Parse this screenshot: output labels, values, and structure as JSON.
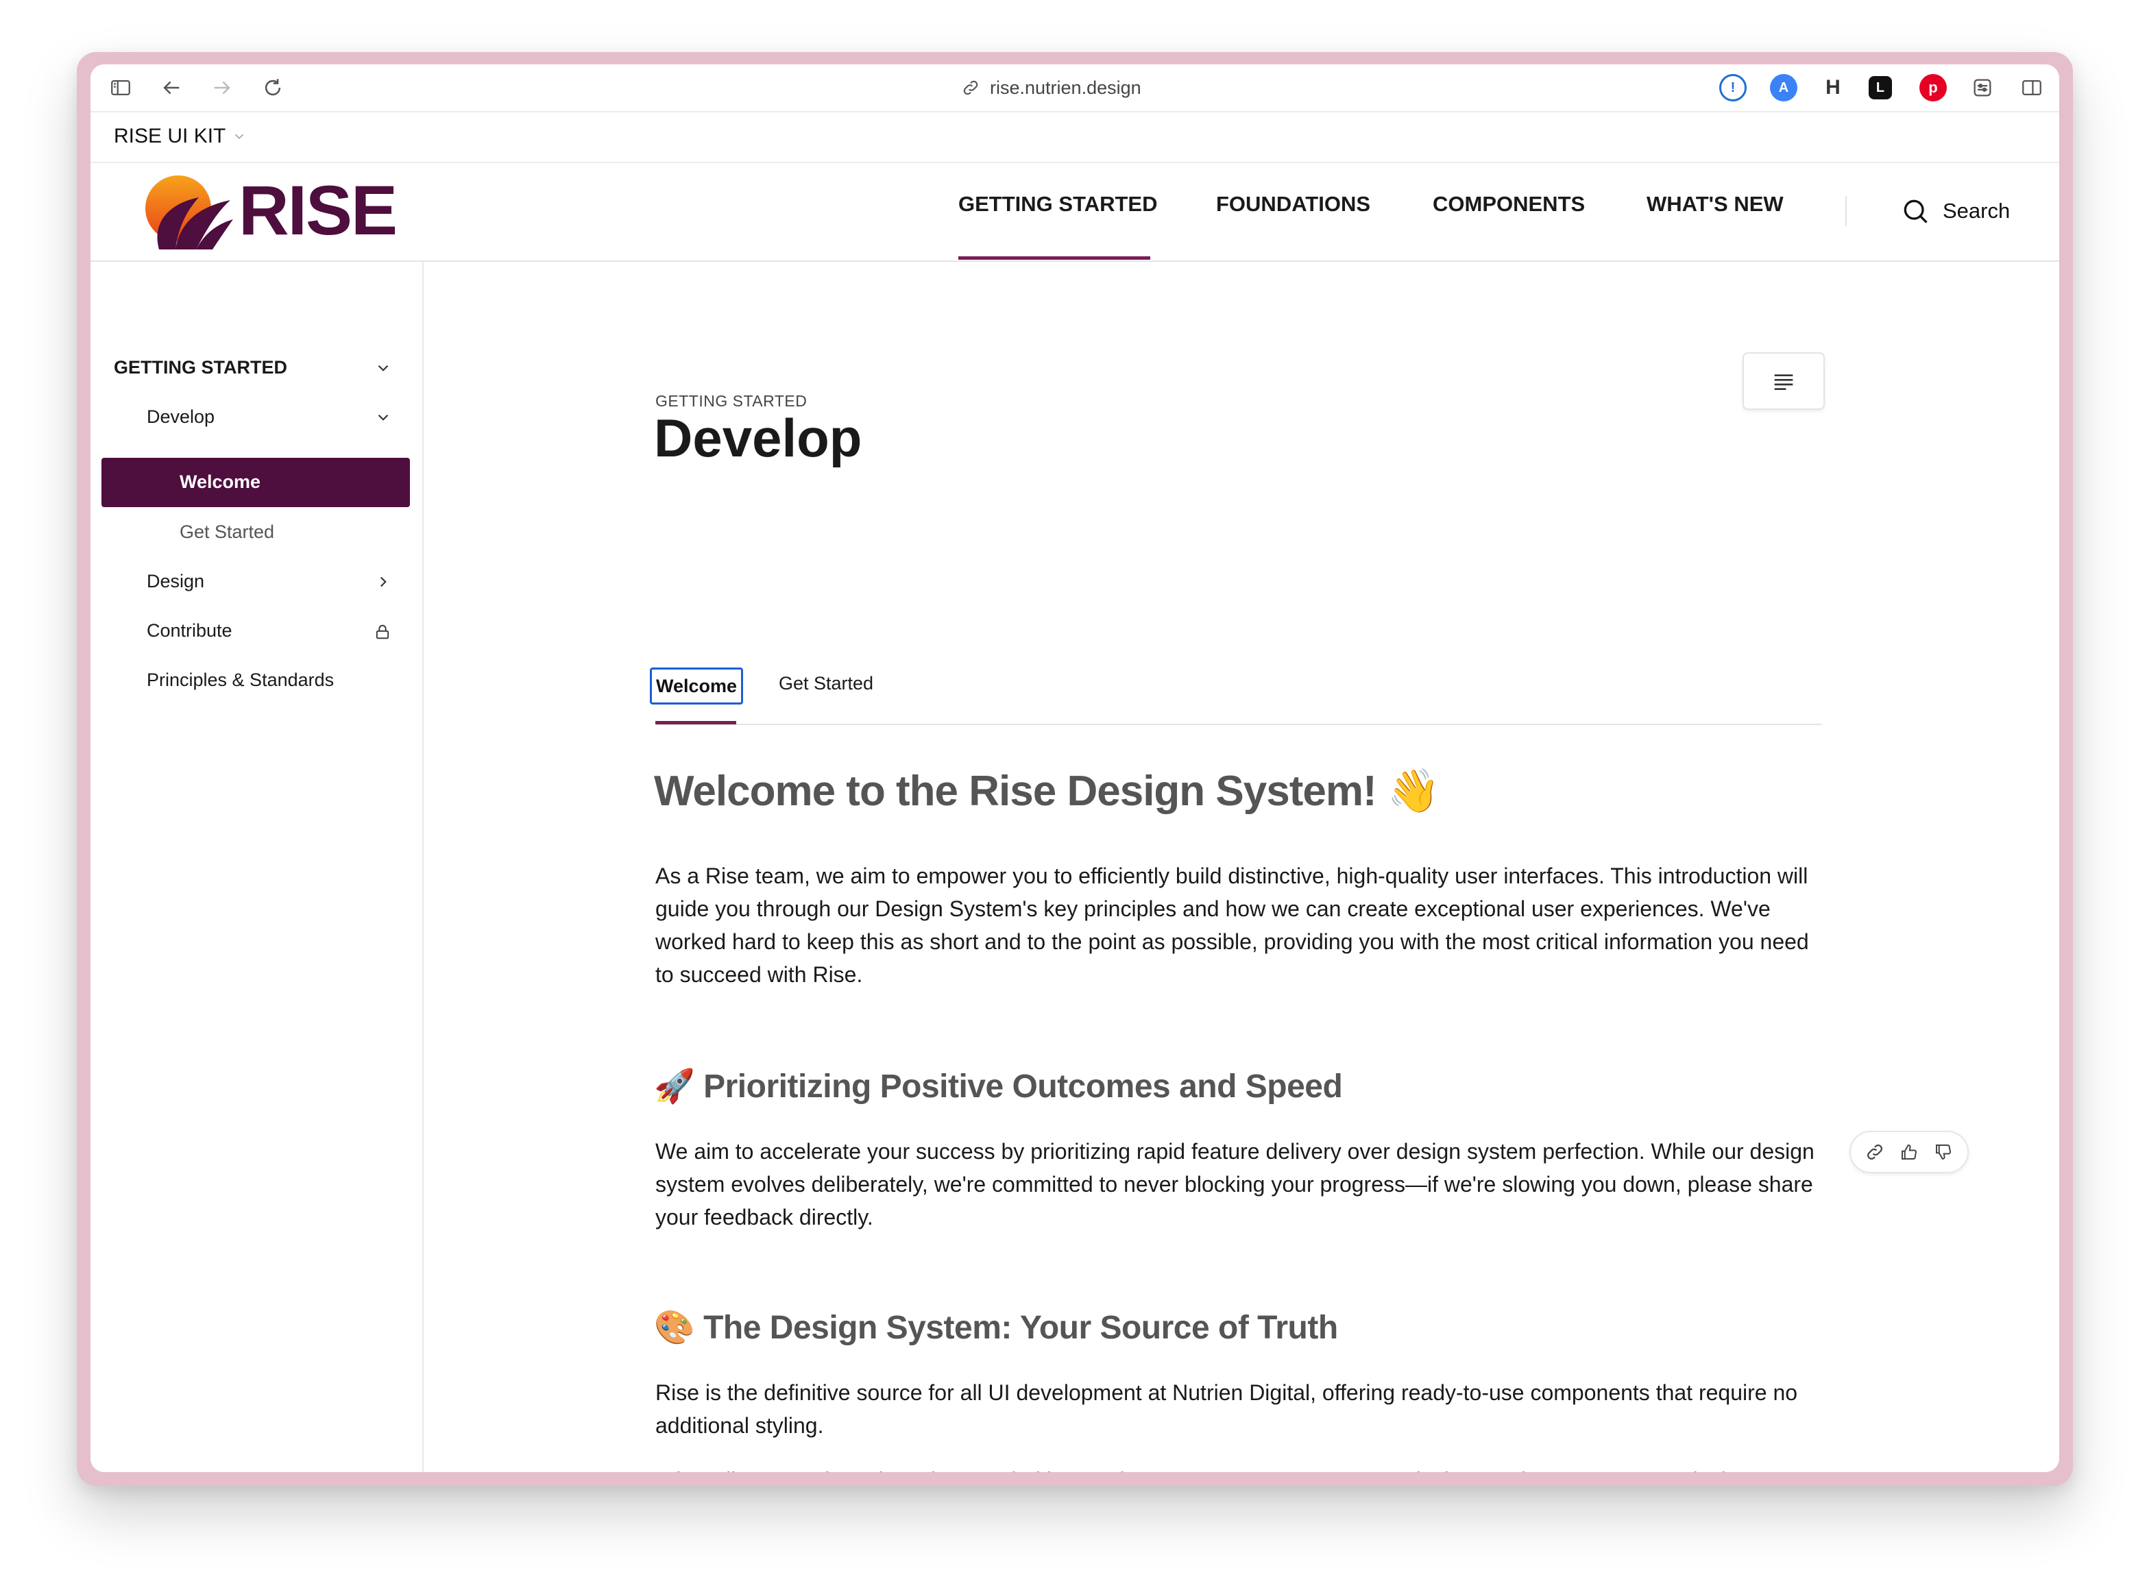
{
  "browser": {
    "url": "rise.nutrien.design"
  },
  "tabbar": {
    "title": "RISE UI KIT"
  },
  "header": {
    "logo_text": "RISE",
    "nav": [
      "GETTING STARTED",
      "FOUNDATIONS",
      "COMPONENTS",
      "WHAT'S NEW"
    ],
    "active_nav": "GETTING STARTED",
    "search_label": "Search"
  },
  "sidebar": {
    "section": "GETTING STARTED",
    "items": [
      {
        "label": "Develop",
        "expanded": true
      },
      {
        "label": "Welcome",
        "active": true
      },
      {
        "label": "Get Started"
      },
      {
        "label": "Design"
      },
      {
        "label": "Contribute",
        "locked": true
      },
      {
        "label": "Principles & Standards"
      }
    ]
  },
  "page": {
    "eyebrow": "GETTING STARTED",
    "title": "Develop",
    "tabs": [
      "Welcome",
      "Get Started"
    ],
    "active_tab": "Welcome",
    "heading": "Welcome to the Rise Design System! 👋",
    "intro": "As a Rise team, we aim to empower you to efficiently build distinctive, high-quality user interfaces. This introduction will guide you through our Design System's key principles and how we can create exceptional user experiences. We've worked hard to keep this as short and to the point as possible, providing you with the most critical information you need to succeed with Rise.",
    "section1_heading": "🚀 Prioritizing Positive Outcomes and Speed",
    "section1_text": "We aim to accelerate your success by prioritizing rapid feature delivery over design system perfection. While our design system evolves deliberately, we're committed to never blocking your progress—if we're slowing you down, please share your feedback directly.",
    "section2_heading": "🎨 The Design System: Your Source of Truth",
    "section2_text1": "Rise is the definitive source for all UI development at Nutrien Digital, offering ready-to-use components that require no additional styling.",
    "section2_text2": "When discrepancies arise, always prioritize Design System components over design mocks. Contact your designer or our team to resolve differences, typically by using the existing component and updating the mock."
  },
  "colors": {
    "brand": "#4e0e3e",
    "accent_underline": "#7a1e5a",
    "focus_ring": "#1a5fd6"
  }
}
